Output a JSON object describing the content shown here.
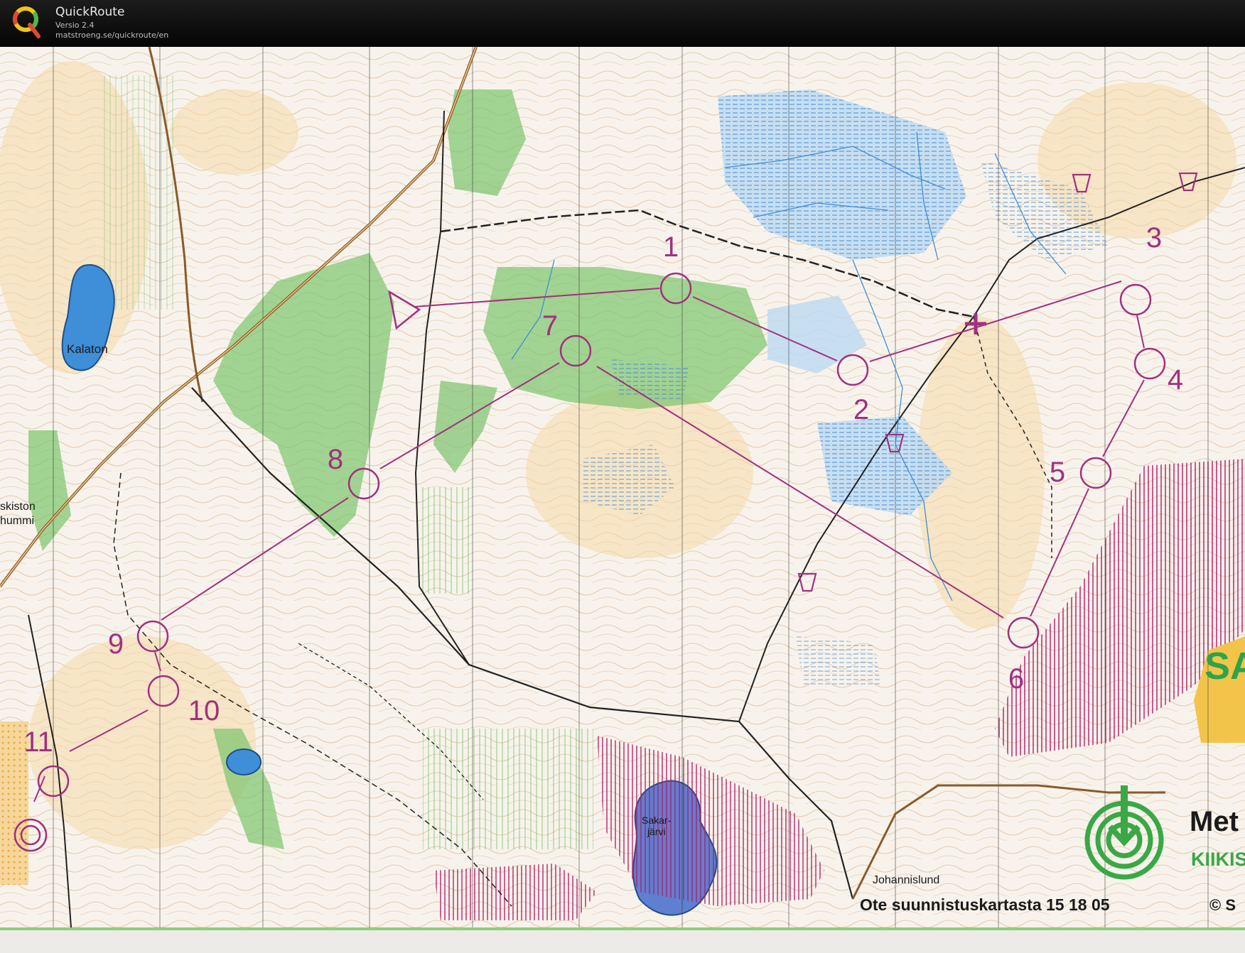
{
  "app": {
    "title": "QuickRoute",
    "version": "Versio 2.4",
    "url": "matstroeng.se/quickroute/en"
  },
  "map": {
    "place_names": {
      "kalaton": "Kalaton",
      "kiskiston": "skiston",
      "hummi": "hummi",
      "sakarjarvi_1": "Sakar-",
      "sakarjarvi_2": "järvi",
      "johannislund": "Johannislund",
      "sa": "SA"
    },
    "footer": {
      "caption": "Ote suunnistuskartasta 15 18 05",
      "brand": "Met",
      "brand_sub": "KIIKIS",
      "copyright": "© S"
    },
    "controls": [
      {
        "number": "1"
      },
      {
        "number": "2"
      },
      {
        "number": "3"
      },
      {
        "number": "4"
      },
      {
        "number": "5"
      },
      {
        "number": "6"
      },
      {
        "number": "7"
      },
      {
        "number": "8"
      },
      {
        "number": "9"
      },
      {
        "number": "10"
      },
      {
        "number": "11"
      }
    ],
    "colors": {
      "course": "#a1307f",
      "water": "#3f8ed8",
      "marsh": "#6aa6de",
      "vegetation": "#6fbd62",
      "contour": "#c9864a",
      "forbidden": "#b0206a",
      "paper": "#f7f3ec"
    }
  }
}
